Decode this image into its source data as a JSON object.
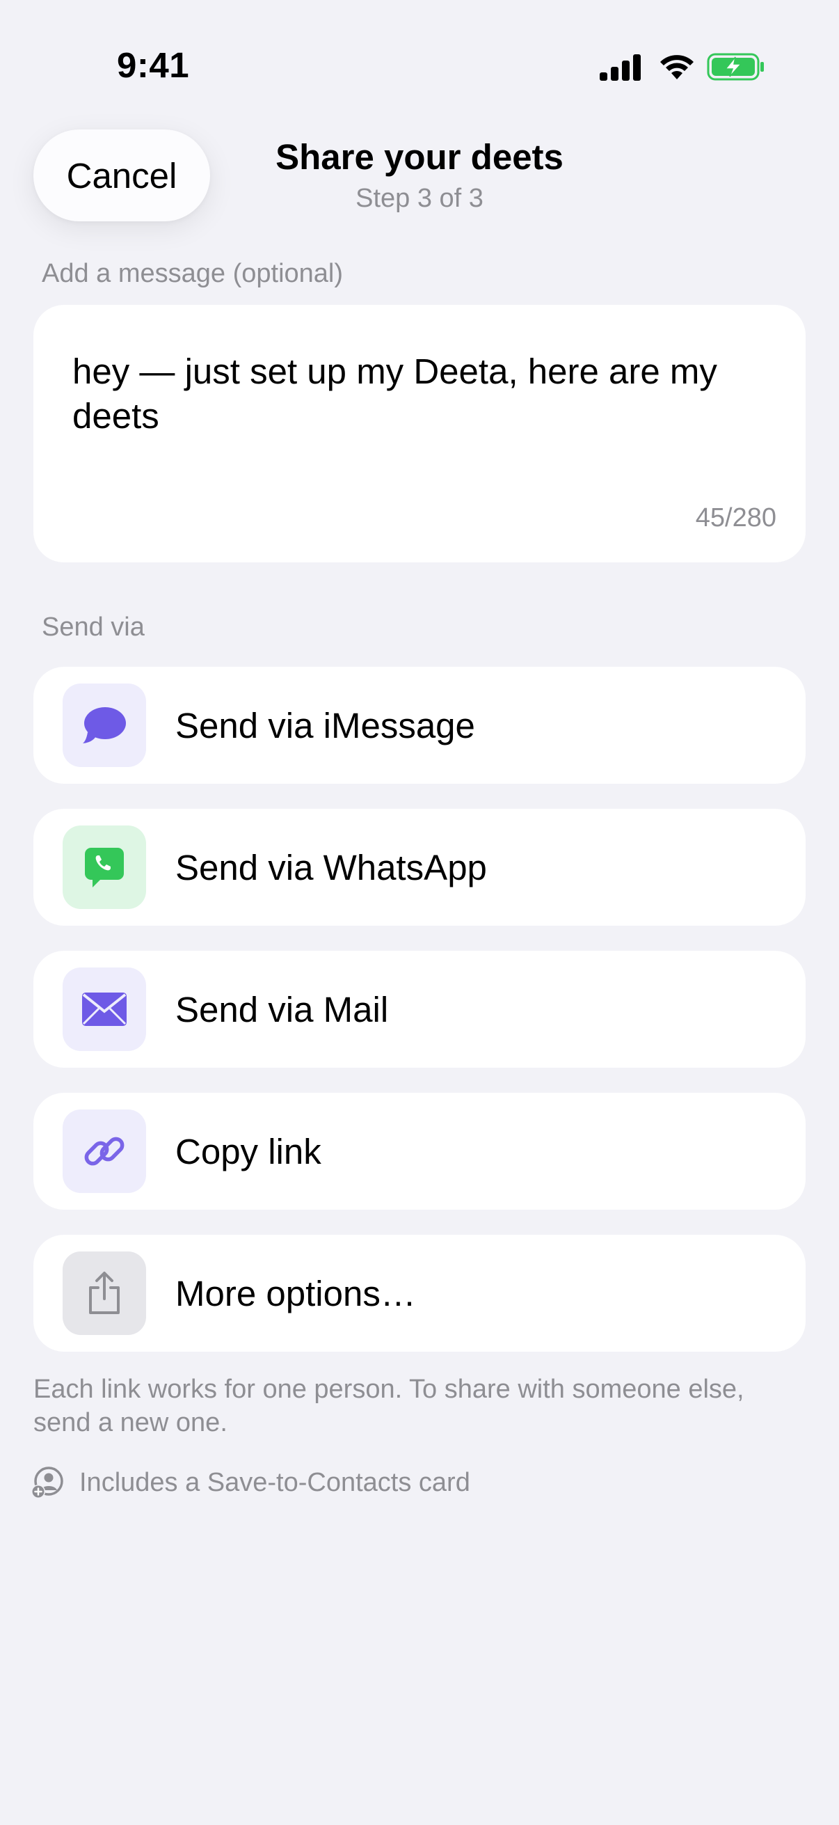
{
  "status_bar": {
    "time": "9:41",
    "icons": [
      "cellular-signal-icon",
      "wifi-icon",
      "battery-charging-icon"
    ],
    "battery_color": "#34C759"
  },
  "header": {
    "cancel_label": "Cancel",
    "title": "Share your deets",
    "subtitle": "Step 3 of 3"
  },
  "message": {
    "section_label": "Add a message (optional)",
    "text": "hey — just set up my Deeta, here are my deets",
    "char_count": "45/280"
  },
  "send_via": {
    "section_label": "Send via",
    "options": [
      {
        "label": "Send via iMessage",
        "icon": "message-bubble-icon",
        "icon_color": "#6E5AE6",
        "tile_color": "#EEEDFC"
      },
      {
        "label": "Send via WhatsApp",
        "icon": "whatsapp-icon",
        "icon_color": "#34C759",
        "tile_color": "#DEF6E4"
      },
      {
        "label": "Send via Mail",
        "icon": "mail-icon",
        "icon_color": "#6E5AE6",
        "tile_color": "#EEEDFC"
      },
      {
        "label": "Copy link",
        "icon": "link-icon",
        "icon_color": "#7A65E8",
        "tile_color": "#EEEDFC"
      },
      {
        "label": "More options…",
        "icon": "share-icon",
        "icon_color": "#8E8E93",
        "tile_color": "#E6E6EA"
      }
    ]
  },
  "footer": {
    "note": "Each link works for one person. To share with someone else, send a new one.",
    "contacts_note": "Includes a Save-to-Contacts card"
  }
}
